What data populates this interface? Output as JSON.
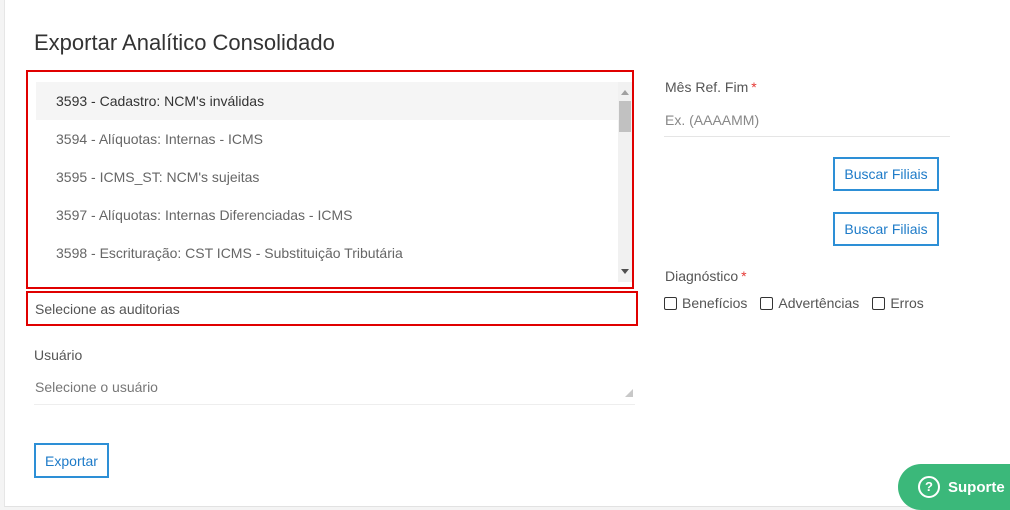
{
  "page": {
    "title": "Exportar Analítico Consolidado"
  },
  "auditorias": {
    "options": [
      "3593 - Cadastro: NCM's inválidas",
      "3594 - Alíquotas: Internas - ICMS",
      "3595 - ICMS_ST: NCM's sujeitas",
      "3597 - Alíquotas: Internas Diferenciadas - ICMS",
      "3598 - Escrituração: CST ICMS - Substituição Tributária"
    ],
    "placeholder": "Selecione as auditorias"
  },
  "usuario": {
    "label": "Usuário",
    "placeholder": "Selecione o usuário"
  },
  "export_button": "Exportar",
  "mes_ref_fim": {
    "label": "Mês Ref. Fim",
    "required_mark": "*",
    "placeholder": "Ex. (AAAAMM)"
  },
  "buscar_filiais_1": "Buscar Filiais",
  "buscar_filiais_2": "Buscar Filiais",
  "diagnostico": {
    "label": "Diagnóstico",
    "required_mark": "*",
    "options": [
      "Benefícios",
      "Advertências",
      "Erros"
    ]
  },
  "support": {
    "label": "Suporte",
    "icon": "question-icon",
    "color": "#3bb87a"
  },
  "colors": {
    "accent": "#2d8fd6",
    "highlight_border": "#e00000",
    "required": "#e53935"
  }
}
